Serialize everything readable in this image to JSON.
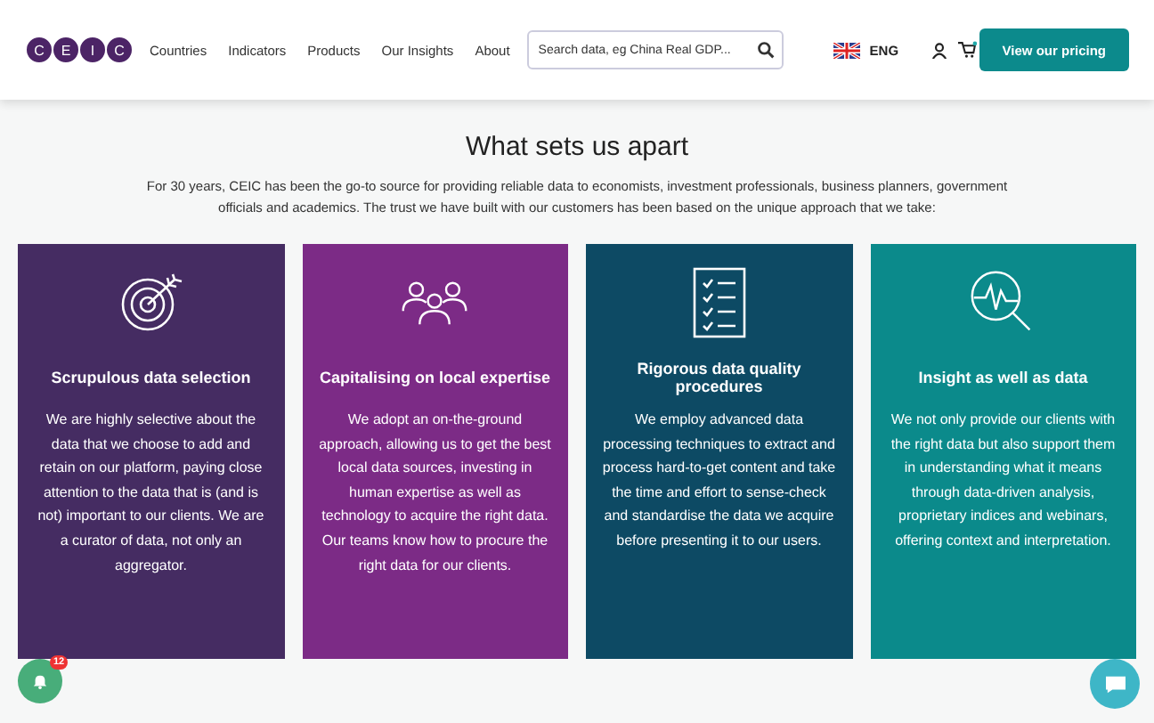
{
  "header": {
    "logo_letters": [
      "C",
      "E",
      "I",
      "C"
    ],
    "nav": [
      {
        "label": "Countries"
      },
      {
        "label": "Indicators"
      },
      {
        "label": "Products"
      },
      {
        "label": "Our Insights"
      },
      {
        "label": "About"
      }
    ],
    "search": {
      "placeholder": "Search data, eg China Real GDP..."
    },
    "language": "ENG",
    "cta": "View our pricing"
  },
  "section": {
    "title": "What sets us apart",
    "intro": "For 30 years, CEIC has been the go-to source for providing reliable data to economists, investment professionals, business planners, government officials and academics. The trust we have built with our customers has been based on the unique approach that we take:",
    "cards": [
      {
        "kind": "target",
        "color": "#452c62",
        "title": "Scrupulous data selection",
        "text": "We are highly selective about the data that we choose to add and retain on our platform, paying close attention to the data that is (and is not) important to our clients. We are a curator of data, not only an aggregator."
      },
      {
        "kind": "people",
        "color": "#7c2b86",
        "title": "Capitalising on local expertise",
        "text": "We adopt an on-the-ground approach, allowing us to get the best local data sources, investing in human expertise as well as technology to acquire the right data. Our teams know how to procure the right data for our clients."
      },
      {
        "kind": "checklist",
        "color": "#0d4a64",
        "title": "Rigorous data quality procedures",
        "text": "We employ advanced data processing techniques to extract and process hard-to-get content and take the time and effort to sense-check and standardise the data we acquire before presenting it to our users."
      },
      {
        "kind": "analysis",
        "color": "#0b8a8b",
        "title": "Insight as well as data",
        "text": "We not only provide our clients with the right data but also support them in understanding what it means through data-driven analysis, proprietary indices and webinars, offering context and interpretation."
      }
    ]
  },
  "notifications": {
    "count": "12"
  }
}
